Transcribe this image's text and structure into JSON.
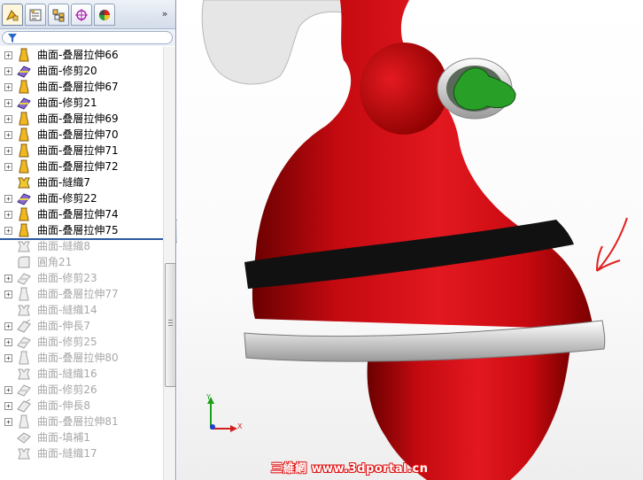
{
  "feature_tree": {
    "items": [
      {
        "label": "曲面-叠層拉伸66",
        "type": "loft-icon",
        "expand": "+",
        "suppressed": false
      },
      {
        "label": "曲面-修剪20",
        "type": "trim-icon",
        "expand": "+",
        "suppressed": false
      },
      {
        "label": "曲面-叠層拉伸67",
        "type": "loft-icon",
        "expand": "+",
        "suppressed": false
      },
      {
        "label": "曲面-修剪21",
        "type": "trim-icon",
        "expand": "+",
        "suppressed": false
      },
      {
        "label": "曲面-叠層拉伸69",
        "type": "loft-icon",
        "expand": "+",
        "suppressed": false
      },
      {
        "label": "曲面-叠層拉伸70",
        "type": "loft-icon",
        "expand": "+",
        "suppressed": false
      },
      {
        "label": "曲面-叠層拉伸71",
        "type": "loft-icon",
        "expand": "+",
        "suppressed": false
      },
      {
        "label": "曲面-叠層拉伸72",
        "type": "loft-icon",
        "expand": "+",
        "suppressed": false
      },
      {
        "label": "曲面-縫織7",
        "type": "knit-icon",
        "expand": "",
        "suppressed": false
      },
      {
        "label": "曲面-修剪22",
        "type": "trim-icon",
        "expand": "+",
        "suppressed": false
      },
      {
        "label": "曲面-叠層拉伸74",
        "type": "loft-icon",
        "expand": "+",
        "suppressed": false
      },
      {
        "label": "曲面-叠層拉伸75",
        "type": "loft-icon",
        "expand": "+",
        "suppressed": false
      },
      {
        "label": "曲面-縫織8",
        "type": "knit-icon",
        "expand": "",
        "suppressed": true
      },
      {
        "label": "圓角21",
        "type": "fillet-icon",
        "expand": "",
        "suppressed": true
      },
      {
        "label": "曲面-修剪23",
        "type": "trim-icon",
        "expand": "+",
        "suppressed": true
      },
      {
        "label": "曲面-叠層拉伸77",
        "type": "loft-icon",
        "expand": "+",
        "suppressed": true
      },
      {
        "label": "曲面-縫織14",
        "type": "knit-icon",
        "expand": "",
        "suppressed": true
      },
      {
        "label": "曲面-伸長7",
        "type": "extend-icon",
        "expand": "+",
        "suppressed": true
      },
      {
        "label": "曲面-修剪25",
        "type": "trim-icon",
        "expand": "+",
        "suppressed": true
      },
      {
        "label": "曲面-叠層拉伸80",
        "type": "loft-icon",
        "expand": "+",
        "suppressed": true
      },
      {
        "label": "曲面-縫織16",
        "type": "knit-icon",
        "expand": "",
        "suppressed": true
      },
      {
        "label": "曲面-修剪26",
        "type": "trim-icon",
        "expand": "+",
        "suppressed": true
      },
      {
        "label": "曲面-伸長8",
        "type": "extend-icon",
        "expand": "+",
        "suppressed": true
      },
      {
        "label": "曲面-叠層拉伸81",
        "type": "loft-icon",
        "expand": "+",
        "suppressed": true
      },
      {
        "label": "曲面-填補1",
        "type": "fill-icon",
        "expand": "",
        "suppressed": true
      },
      {
        "label": "曲面-縫織17",
        "type": "knit-icon",
        "expand": "",
        "suppressed": true
      }
    ]
  },
  "tabs": [
    {
      "name": "feature-manager-tab-icon"
    },
    {
      "name": "property-manager-tab-icon"
    },
    {
      "name": "configuration-manager-tab-icon"
    },
    {
      "name": "dimxpert-manager-tab-icon"
    },
    {
      "name": "display-manager-tab-icon"
    }
  ],
  "collapse_glyph": "»",
  "splitter_glyph": "‹‹",
  "triad": {
    "y_label": "Y",
    "x_label": "X"
  },
  "watermark": "三維網 www.3dportal.cn",
  "colors": {
    "model_red": "#d01218",
    "belt_black": "#111111",
    "trim_white": "#eeeeee",
    "glove_green": "#28a028",
    "annotation_red": "#e02020",
    "feature_yellow": "#f0b820",
    "trim_purple": "#8a6ad0"
  }
}
